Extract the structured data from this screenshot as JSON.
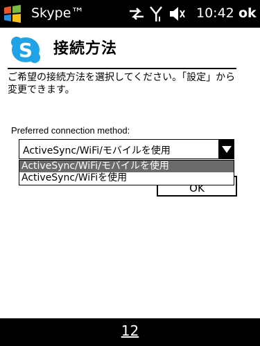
{
  "statusbar": {
    "app_title": "Skype™",
    "time": "10:42",
    "ok_label": "ok",
    "icons": [
      "windows-start-icon",
      "sync-arrows-icon",
      "signal-icon",
      "speaker-muted-icon"
    ]
  },
  "header": {
    "logo_icon": "skype-logo-icon",
    "title": "接続方法",
    "accent_color": "#1fa3e6"
  },
  "instructions": "ご希望の接続方法を選択してください。「設定」から変更できます。",
  "form": {
    "label": "Preferred connection method:",
    "selected_value": "ActiveSync/WiFi/モバイルを使用",
    "options": [
      "ActiveSync/WiFi/モバイルを使用",
      "ActiveSync/WiFiを使用"
    ],
    "ok_button": "OK"
  },
  "bottombar": {
    "softkey": "12"
  }
}
